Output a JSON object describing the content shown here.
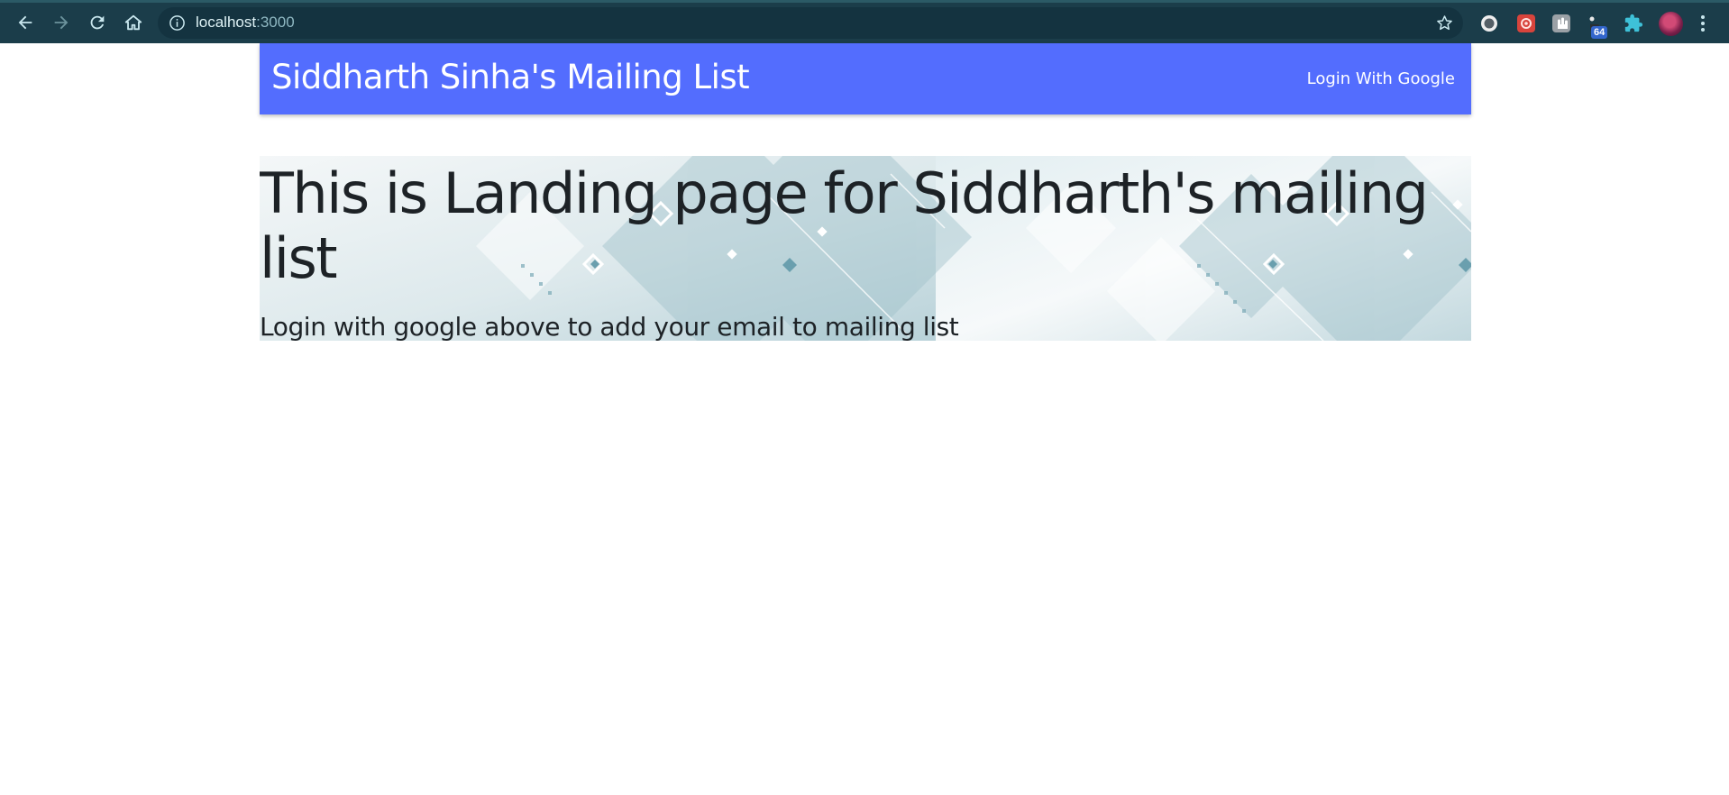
{
  "browser": {
    "url_host": "localhost",
    "url_port": ":3000",
    "extension_badge": "64",
    "icons": [
      "back-arrow-icon",
      "forward-arrow-icon",
      "reload-icon",
      "home-icon",
      "info-icon",
      "star-icon",
      "circle-extension-icon",
      "red-extension-icon",
      "grey-extension-icon",
      "dark-extension-icon",
      "puzzle-icon",
      "profile-avatar",
      "more-vert-icon"
    ]
  },
  "navbar": {
    "brand": "Siddharth Sinha's Mailing List",
    "login_label": "Login With Google",
    "color": "#536dfe"
  },
  "hero": {
    "title": "This is Landing page for Siddharth's mailing list",
    "subtitle": "Login with google above to add your email to mailing list"
  }
}
